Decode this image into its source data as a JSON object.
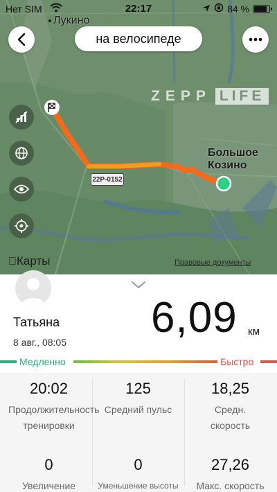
{
  "status_bar": {
    "carrier": "Нет SIM",
    "time": "22:17",
    "battery_text": "84 %",
    "battery_level": 0.84,
    "icons": [
      "wifi-icon",
      "location-arrow-icon",
      "orientation-lock-icon",
      "battery-icon"
    ]
  },
  "header": {
    "back_icon": "chevron-left-icon",
    "activity_mode": "на велосипеде",
    "more_icon": "ellipsis-icon"
  },
  "map": {
    "places": {
      "lukino": "Лукино",
      "kozino": "Большое Козино"
    },
    "road_badge": "22Р-0152",
    "watermark_zepp": "ZEPP",
    "watermark_life": "LIFE",
    "tools": [
      "segments-icon",
      "globe-icon",
      "eye-icon",
      "locate-icon"
    ],
    "provider": "Карты",
    "legal": "Правовые документы",
    "colors": {
      "route": "#f26a1b",
      "start_marker": "#2fcf84",
      "finish_flag": "#222222"
    }
  },
  "workout": {
    "user_name": "Татьяна",
    "date": "8 авг., 08:05",
    "distance": "6,09",
    "distance_unit": "км",
    "pace_slow_label": "Медленно",
    "pace_fast_label": "Быстро",
    "colors": {
      "slow": "#2fb07a",
      "fast": "#e0554e"
    }
  },
  "stats": [
    {
      "value": "20:02",
      "label": "Продолжительность тренировки"
    },
    {
      "value": "125",
      "label": "Средний пульс"
    },
    {
      "value": "18,25",
      "label": "Средн. скорость"
    },
    {
      "value": "0",
      "label": "Увеличение"
    },
    {
      "value": "0",
      "label": "Уменьшение высоты"
    },
    {
      "value": "27,26",
      "label": "Макс. скорость"
    }
  ]
}
